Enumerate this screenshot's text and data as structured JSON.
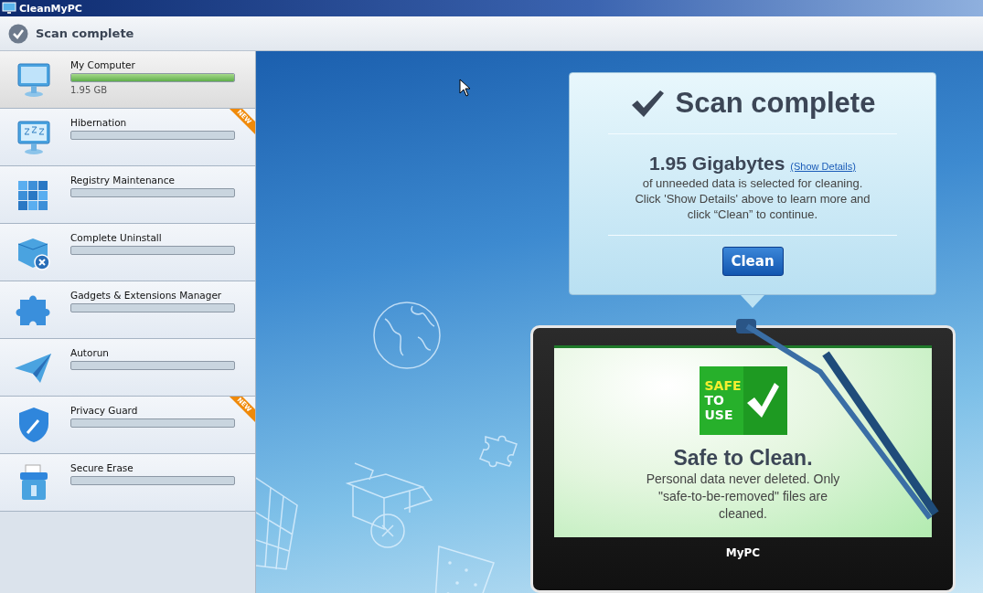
{
  "window": {
    "title": "CleanMyPC"
  },
  "header": {
    "title": "Scan complete"
  },
  "sidebar": {
    "items": [
      {
        "kind": "monitor",
        "label": "My Computer",
        "selected": true,
        "level": 1,
        "size": "1.95 GB"
      },
      {
        "kind": "sleep",
        "label": "Hibernation",
        "selected": false,
        "level": 0,
        "badge": "NEW"
      },
      {
        "kind": "blocks",
        "label": "Registry Maintenance",
        "selected": false,
        "level": 0
      },
      {
        "kind": "box",
        "label": "Complete Uninstall",
        "selected": false,
        "level": 0
      },
      {
        "kind": "puzzle",
        "label": "Gadgets & Extensions Manager",
        "selected": false,
        "level": 0
      },
      {
        "kind": "plane",
        "label": "Autorun",
        "selected": false,
        "level": 0
      },
      {
        "kind": "shield",
        "label": "Privacy Guard",
        "selected": false,
        "level": 0,
        "badge": "NEW"
      },
      {
        "kind": "shredder",
        "label": "Secure Erase",
        "selected": false,
        "level": 0
      }
    ]
  },
  "popup": {
    "title": "Scan complete",
    "amount": "1.95 Gigabytes",
    "link": "(Show Details)",
    "message": "of unneeded data is selected for cleaning. Click 'Show Details' above to learn more and click “Clean” to continue.",
    "button": "Clean"
  },
  "monitor": {
    "badge": [
      "SAFE",
      "TO",
      "USE"
    ],
    "heading": "Safe to Clean.",
    "message": "Personal data never deleted. Only \"safe-to-be-removed\" files are cleaned.",
    "brand": "MyPC"
  }
}
